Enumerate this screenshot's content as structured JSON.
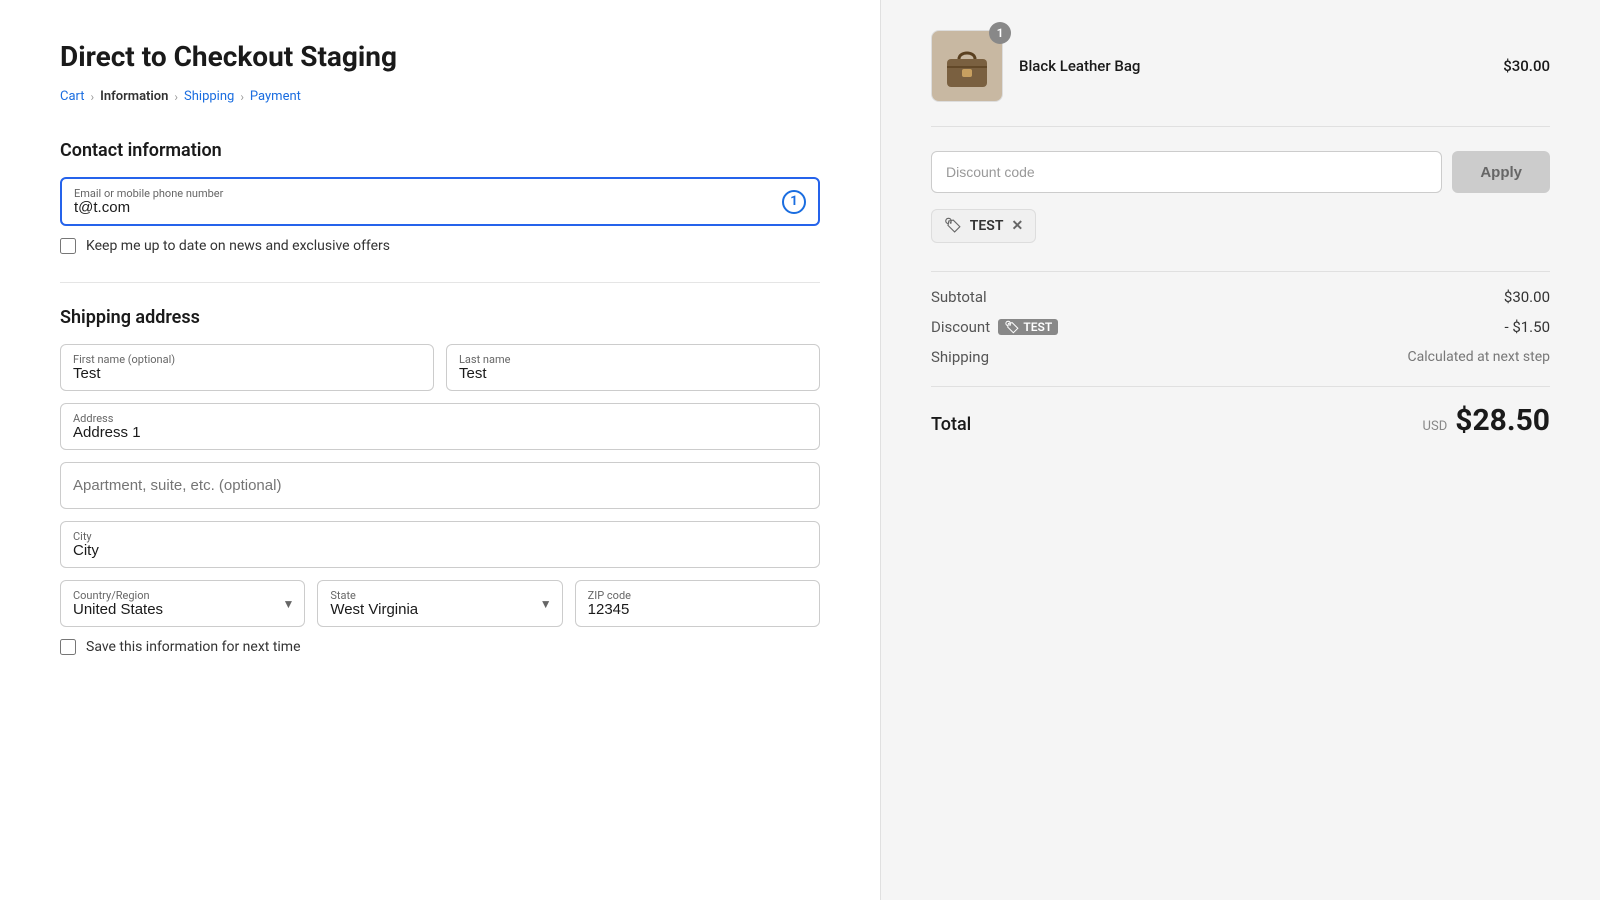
{
  "page": {
    "title": "Direct to Checkout Staging"
  },
  "breadcrumb": {
    "items": [
      {
        "label": "Cart",
        "active": false
      },
      {
        "label": "Information",
        "active": true
      },
      {
        "label": "Shipping",
        "active": false
      },
      {
        "label": "Payment",
        "active": false
      }
    ]
  },
  "contact": {
    "section_title": "Contact information",
    "email_label": "Email or mobile phone number",
    "email_value": "t@t.com",
    "newsletter_label": "Keep me up to date on news and exclusive offers"
  },
  "shipping": {
    "section_title": "Shipping address",
    "first_name_label": "First name (optional)",
    "first_name_value": "Test",
    "last_name_label": "Last name",
    "last_name_value": "Test",
    "address_label": "Address",
    "address_value": "Address 1",
    "apt_placeholder": "Apartment, suite, etc. (optional)",
    "city_label": "City",
    "city_value": "City",
    "country_label": "Country/Region",
    "country_value": "United States",
    "state_label": "State",
    "state_value": "West Virginia",
    "zip_label": "ZIP code",
    "zip_value": "12345",
    "save_label": "Save this information for next time"
  },
  "order": {
    "product_name": "Black Leather Bag",
    "product_price": "$30.00",
    "product_quantity": "1",
    "discount_placeholder": "Discount code",
    "apply_button": "Apply",
    "discount_code": "TEST",
    "subtotal_label": "Subtotal",
    "subtotal_value": "$30.00",
    "discount_label": "Discount",
    "discount_badge": "TEST",
    "discount_value": "- $1.50",
    "shipping_label": "Shipping",
    "shipping_value": "Calculated at next step",
    "total_label": "Total",
    "total_currency": "USD",
    "total_amount": "$28.50"
  }
}
